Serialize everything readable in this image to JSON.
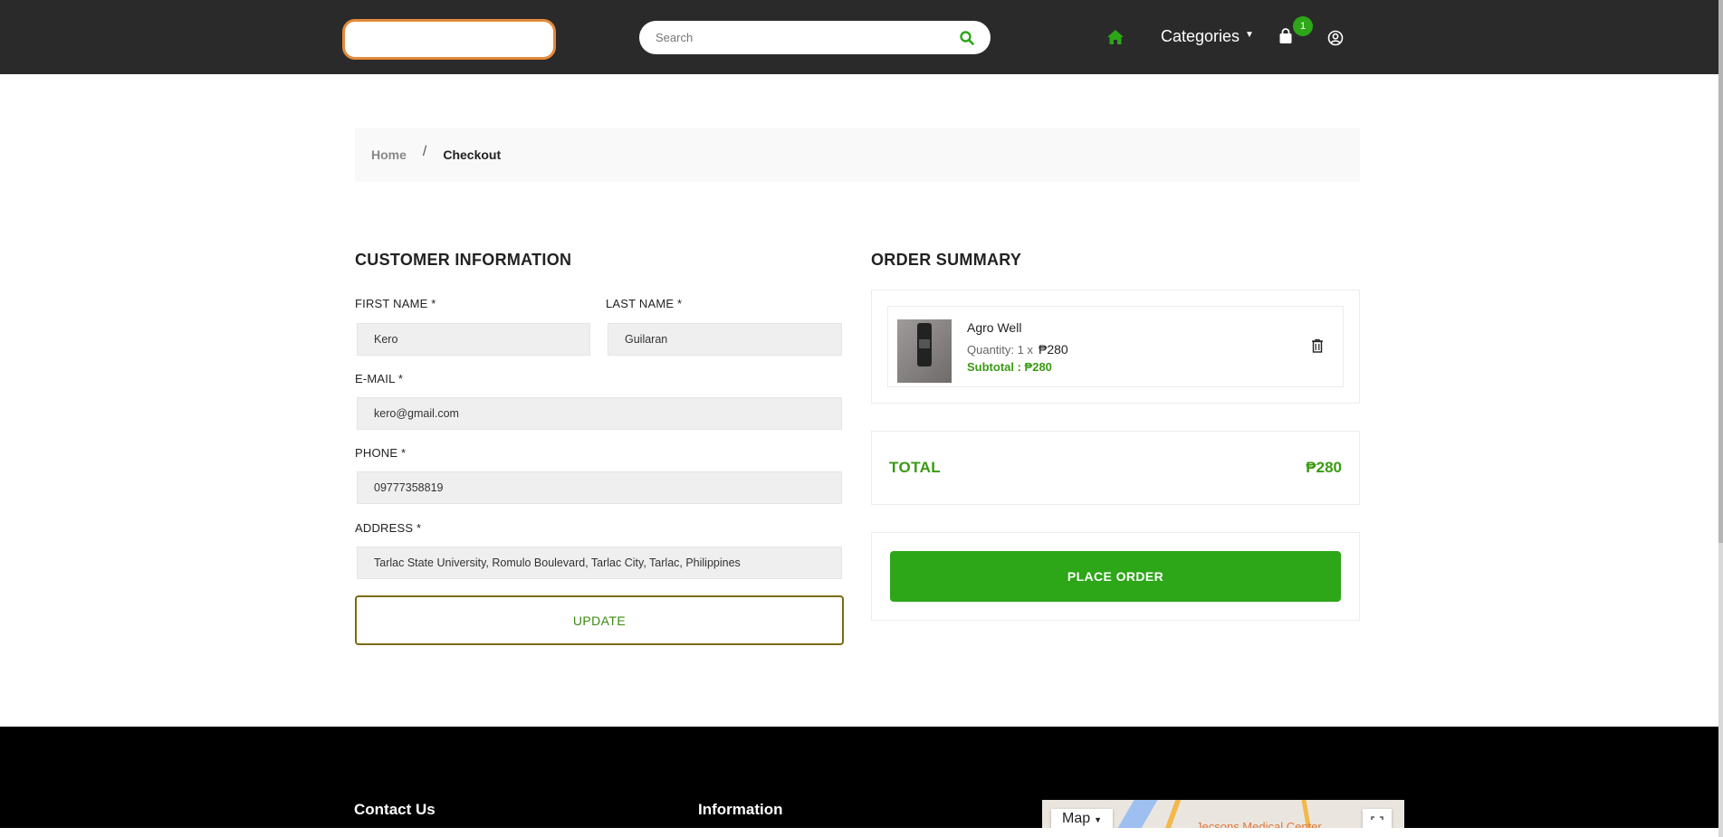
{
  "header": {
    "search_placeholder": "Search",
    "nav_categories": "Categories",
    "cart_count": "1"
  },
  "breadcrumb": {
    "home": "Home",
    "separator": "/",
    "current": "Checkout"
  },
  "customer": {
    "title": "CUSTOMER INFORMATION",
    "first_name_label": "FIRST NAME *",
    "first_name_value": "Kero",
    "last_name_label": "LAST NAME *",
    "last_name_value": "Guilaran",
    "email_label": "E-MAIL *",
    "email_value": "kero@gmail.com",
    "phone_label": "PHONE *",
    "phone_value": "09777358819",
    "address_label": "ADDRESS *",
    "address_value": "Tarlac State University, Romulo Boulevard, Tarlac City, Tarlac, Philippines",
    "update_label": "UPDATE"
  },
  "summary": {
    "title": "ORDER SUMMARY",
    "item_name": "Agro Well",
    "item_qty_prefix": "Quantity: 1 x",
    "item_price": "₱280",
    "item_subtotal": "Subtotal : ₱280",
    "total_label": "TOTAL",
    "total_value": "₱280",
    "place_order_label": "PLACE ORDER"
  },
  "footer": {
    "contact_heading": "Contact Us",
    "info_heading": "Information",
    "map_type_label": "Map",
    "map_place_label": "Jecsons Medical Center"
  },
  "colors": {
    "accent_green": "#2da618",
    "header_bg": "#2a2a2a",
    "logo_border": "#e3893a",
    "update_border": "#7a6a10"
  }
}
